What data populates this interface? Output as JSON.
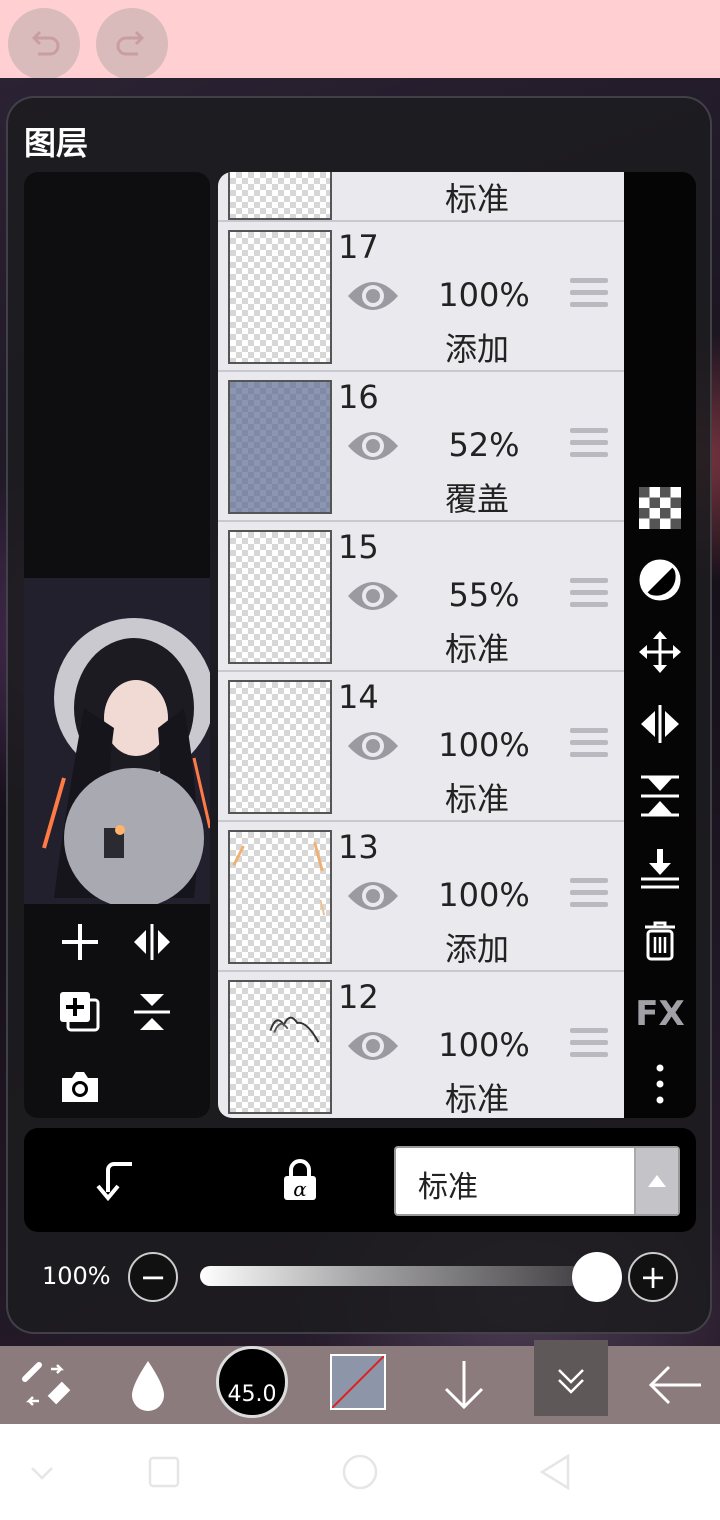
{
  "top_bar": {
    "undo_icon": "undo-icon",
    "redo_icon": "redo-icon",
    "background": "#ffcfd2"
  },
  "panel": {
    "title": "图层"
  },
  "layers": [
    {
      "number": "",
      "opacity": "",
      "blend": "标准",
      "partial": true
    },
    {
      "number": "17",
      "opacity": "100%",
      "blend": "添加"
    },
    {
      "number": "16",
      "opacity": "52%",
      "blend": "覆盖"
    },
    {
      "number": "15",
      "opacity": "55%",
      "blend": "标准"
    },
    {
      "number": "14",
      "opacity": "100%",
      "blend": "标准"
    },
    {
      "number": "13",
      "opacity": "100%",
      "blend": "添加"
    },
    {
      "number": "12",
      "opacity": "100%",
      "blend": "标准"
    }
  ],
  "right_tools": {
    "fx_label": "FX"
  },
  "bottom_panel": {
    "blend_mode": "标准"
  },
  "opacity_slider": {
    "label": "100%",
    "value": 1.0,
    "minus": "−",
    "plus": "+"
  },
  "toolbar": {
    "brush_size": "45.0",
    "primary_color": "#8d95a8"
  }
}
